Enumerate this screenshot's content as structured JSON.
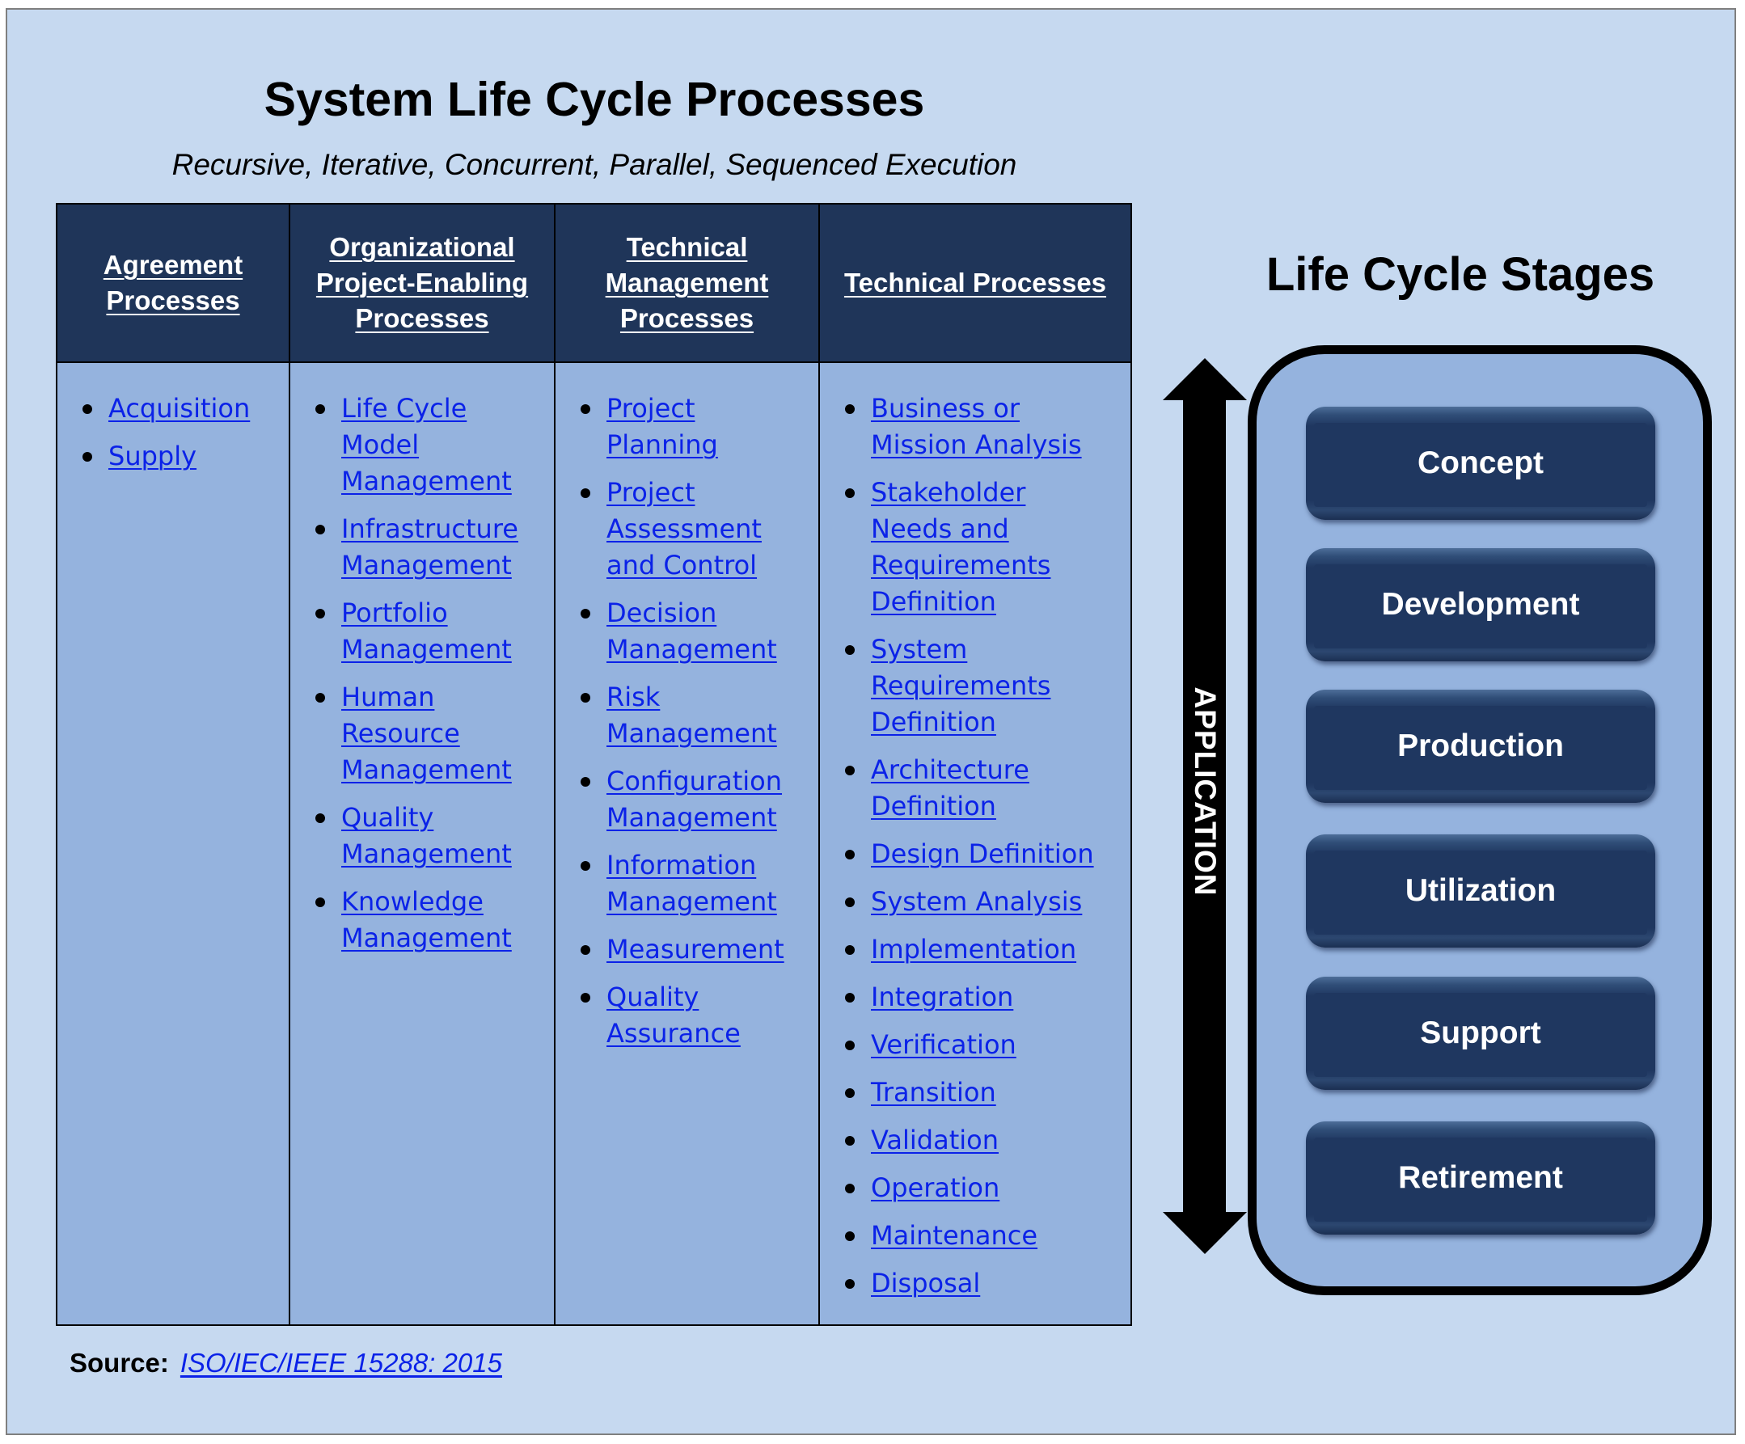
{
  "title": "System Life Cycle Processes",
  "subtitle": "Recursive, Iterative, Concurrent, Parallel, Sequenced Execution",
  "colors": {
    "background": "#c6d9f0",
    "header_bg": "#1f3559",
    "body_bg": "#95b3de",
    "link": "#0b22e8",
    "stage_button": "#1f3760"
  },
  "process_groups": [
    {
      "header": "Agreement Processes",
      "items": [
        "Acquisition",
        "Supply"
      ]
    },
    {
      "header": "Organizational Project-Enabling Processes",
      "items": [
        "Life Cycle Model Management",
        "Infrastructure Management",
        "Portfolio Management",
        "Human Resource Management",
        "Quality Management",
        "Knowledge Management"
      ]
    },
    {
      "header": "Technical Management Processes",
      "items": [
        "Project Planning",
        "Project Assessment and Control",
        "Decision Management",
        "Risk Management",
        "Configuration Management",
        "Information Management",
        "Measurement",
        "Quality Assurance"
      ]
    },
    {
      "header": "Technical Processes",
      "items": [
        "Business or Mission Analysis",
        "Stakeholder Needs and Requirements Definition",
        "System Requirements Definition",
        "Architecture Definition",
        "Design Definition",
        "System Analysis",
        "Implementation",
        "Integration",
        "Verification",
        "Transition",
        "Validation",
        "Operation",
        "Maintenance",
        "Disposal"
      ]
    }
  ],
  "source": {
    "label": "Source:",
    "link_text": "ISO/IEC/IEEE 15288: 2015"
  },
  "stages": {
    "title": "Life Cycle Stages",
    "arrow_label": "APPLICATION",
    "arrow_icon": "double-headed-vertical-arrow",
    "items": [
      "Concept",
      "Development",
      "Production",
      "Utilization",
      "Support",
      "Retirement"
    ]
  }
}
